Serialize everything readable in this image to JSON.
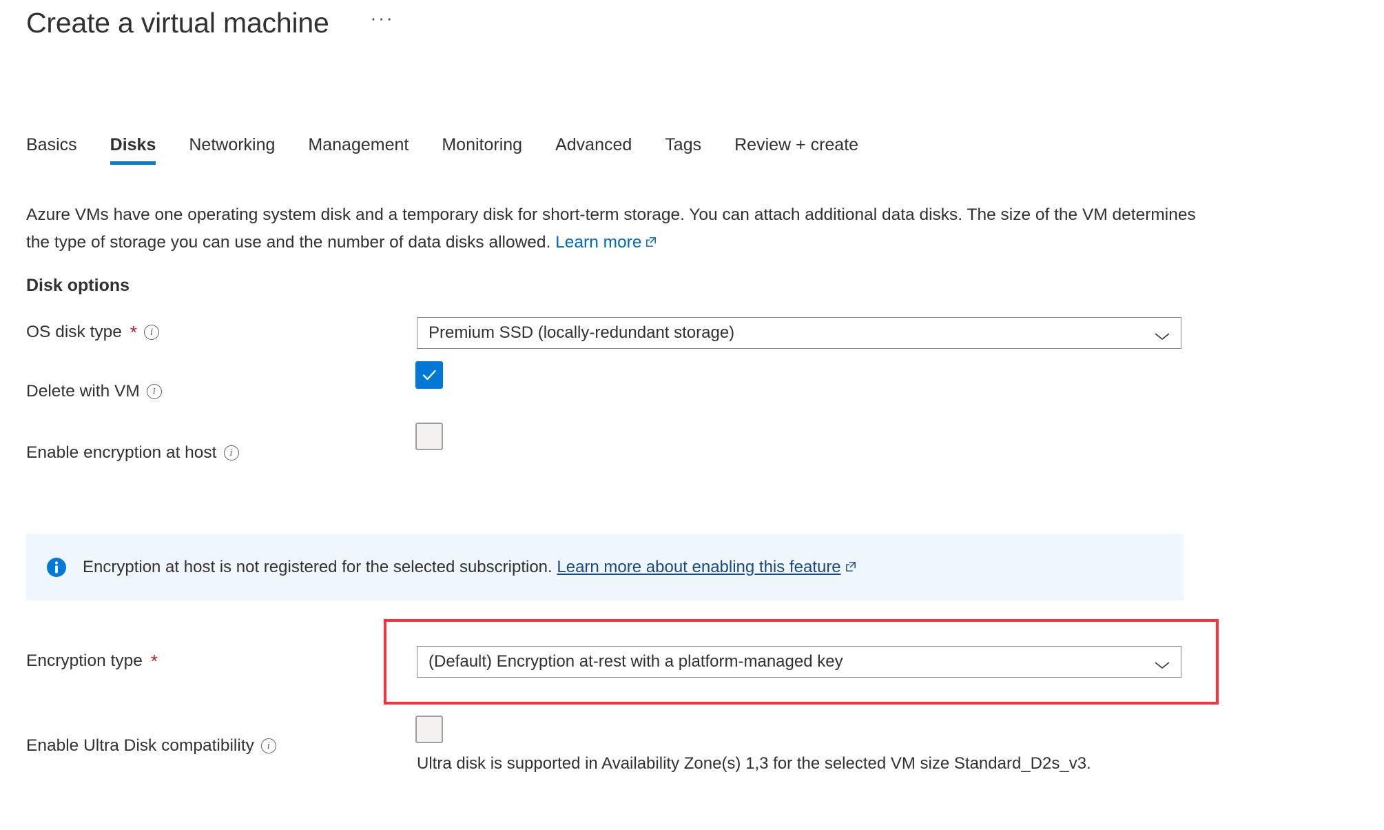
{
  "header": {
    "title": "Create a virtual machine",
    "more_menu": "···"
  },
  "tabs": [
    {
      "label": "Basics",
      "active": false
    },
    {
      "label": "Disks",
      "active": true
    },
    {
      "label": "Networking",
      "active": false
    },
    {
      "label": "Management",
      "active": false
    },
    {
      "label": "Monitoring",
      "active": false
    },
    {
      "label": "Advanced",
      "active": false
    },
    {
      "label": "Tags",
      "active": false
    },
    {
      "label": "Review + create",
      "active": false
    }
  ],
  "intro": {
    "line1": "Azure VMs have one operating system disk and a temporary disk for short-term storage. You can attach additional data disks.",
    "line2": "The size of the VM determines the type of storage you can use and the number of data disks allowed.",
    "link_label": "Learn more"
  },
  "section": {
    "heading": "Disk options"
  },
  "fields": {
    "os_disk_type": {
      "label": "OS disk type",
      "required": "*",
      "info": "i",
      "value": "Premium SSD (locally-redundant storage)"
    },
    "delete_with_vm": {
      "label": "Delete with VM",
      "info": "i",
      "checked": true
    },
    "enable_encryption_at_host": {
      "label": "Enable encryption at host",
      "info": "i",
      "checked": false
    },
    "encryption_type": {
      "label": "Encryption type",
      "required": "*",
      "value": "(Default) Encryption at-rest with a platform-managed key"
    },
    "enable_ultra_disk": {
      "label": "Enable Ultra Disk compatibility",
      "info": "i",
      "checked": false,
      "helper_text": "Ultra disk is supported in Availability Zone(s) 1,3 for the selected VM size Standard_D2s_v3."
    }
  },
  "banner": {
    "icon": "info-filled-icon",
    "message": "Encryption at host is not registered for the selected subscription.",
    "link_label": "Learn more about enabling this feature"
  },
  "colors": {
    "accent_blue": "#0078d4",
    "link_blue": "#0067b8",
    "banner_link_blue": "#1b4a82",
    "banner_bg": "#eff6fc",
    "required_red": "#a4262c",
    "highlight_red": "#f5333f",
    "text": "#323130",
    "border_gray": "#8a8886"
  }
}
